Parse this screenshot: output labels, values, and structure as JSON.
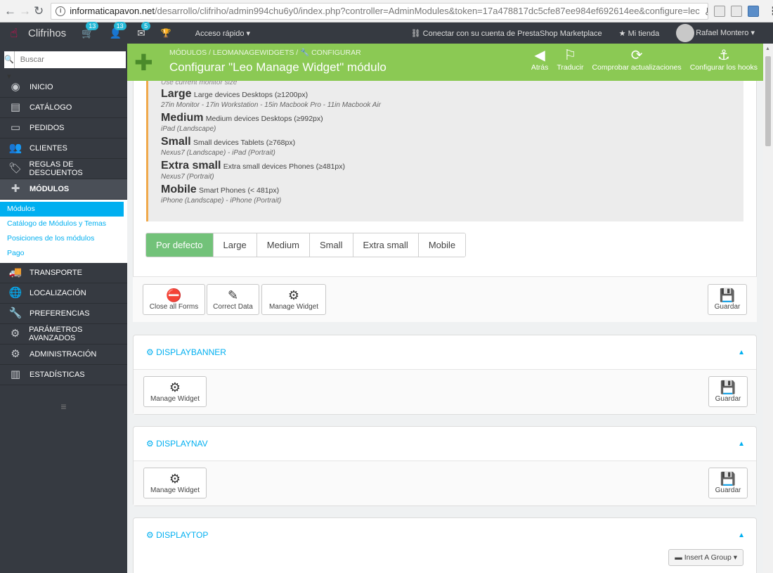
{
  "browser": {
    "url_domain": "informaticapavon.net",
    "url_path": "/desarrollo/clifriho/admin994chu6y0/index.php?controller=AdminModules&token=17a478817dc5cfe87ee984ef692614ee&configure=lec"
  },
  "topbar": {
    "shop_name": "Clifrihos",
    "orders_count": "13",
    "customers_count": "13",
    "messages_count": "5",
    "quick_access": "Acceso rápido ▾",
    "marketplace": "Conectar con su cuenta de PrestaShop Marketplace",
    "my_shop": "Mi tienda",
    "user": "Rafael Montero ▾"
  },
  "sidebar": {
    "search_placeholder": "Buscar",
    "items": [
      {
        "label": "INICIO"
      },
      {
        "label": "CATÁLOGO"
      },
      {
        "label": "PEDIDOS"
      },
      {
        "label": "CLIENTES"
      },
      {
        "label": "REGLAS DE DESCUENTOS"
      },
      {
        "label": "MÓDULOS"
      },
      {
        "label": "TRANSPORTE"
      },
      {
        "label": "LOCALIZACIÓN"
      },
      {
        "label": "PREFERENCIAS"
      },
      {
        "label": "PARÁMETROS AVANZADOS"
      },
      {
        "label": "ADMINISTRACIÓN"
      },
      {
        "label": "ESTADÍSTICAS"
      }
    ],
    "submenu": [
      "Módulos",
      "Catálogo de Módulos y Temas",
      "Posiciones de los módulos",
      "Pago"
    ]
  },
  "header": {
    "breadcrumb": "MÓDULOS  /  LEOMANAGEWIDGETS  /  🔧 CONFIGURAR",
    "title": "Configurar \"Leo Manage Widget\" módulo",
    "toolbar": [
      "Atrás",
      "Traducir",
      "Comprobar actualizaciones",
      "Configurar los hooks"
    ]
  },
  "devices": {
    "cut_text": "Use current monitor size",
    "rows": [
      {
        "name": "Large",
        "desc": "Large devices Desktops (≥1200px)",
        "sub": "27in Monitor - 17in Workstation - 15in Macbook Pro - 11in Macbook Air"
      },
      {
        "name": "Medium",
        "desc": "Medium devices Desktops (≥992px)",
        "sub": "iPad (Landscape)"
      },
      {
        "name": "Small",
        "desc": "Small devices Tablets (≥768px)",
        "sub": "Nexus7 (Landscape) - iPad (Portrait)"
      },
      {
        "name": "Extra small",
        "desc": "Extra small devices Phones (≥481px)",
        "sub": "Nexus7 (Portrait)"
      },
      {
        "name": "Mobile",
        "desc": "Smart Phones (< 481px)",
        "sub": "iPhone (Landscape) - iPhone (Portrait)"
      }
    ],
    "tabs": [
      "Por defecto",
      "Large",
      "Medium",
      "Small",
      "Extra small",
      "Mobile"
    ]
  },
  "actions": {
    "close_all": "Close all Forms",
    "correct_data": "Correct Data",
    "manage_widget": "Manage Widget",
    "save": "Guardar"
  },
  "hooks": [
    {
      "name": "DISPLAYBANNER"
    },
    {
      "name": "DISPLAYNAV"
    },
    {
      "name": "DISPLAYTOP"
    }
  ],
  "insert_group": "Insert A Group ▾"
}
